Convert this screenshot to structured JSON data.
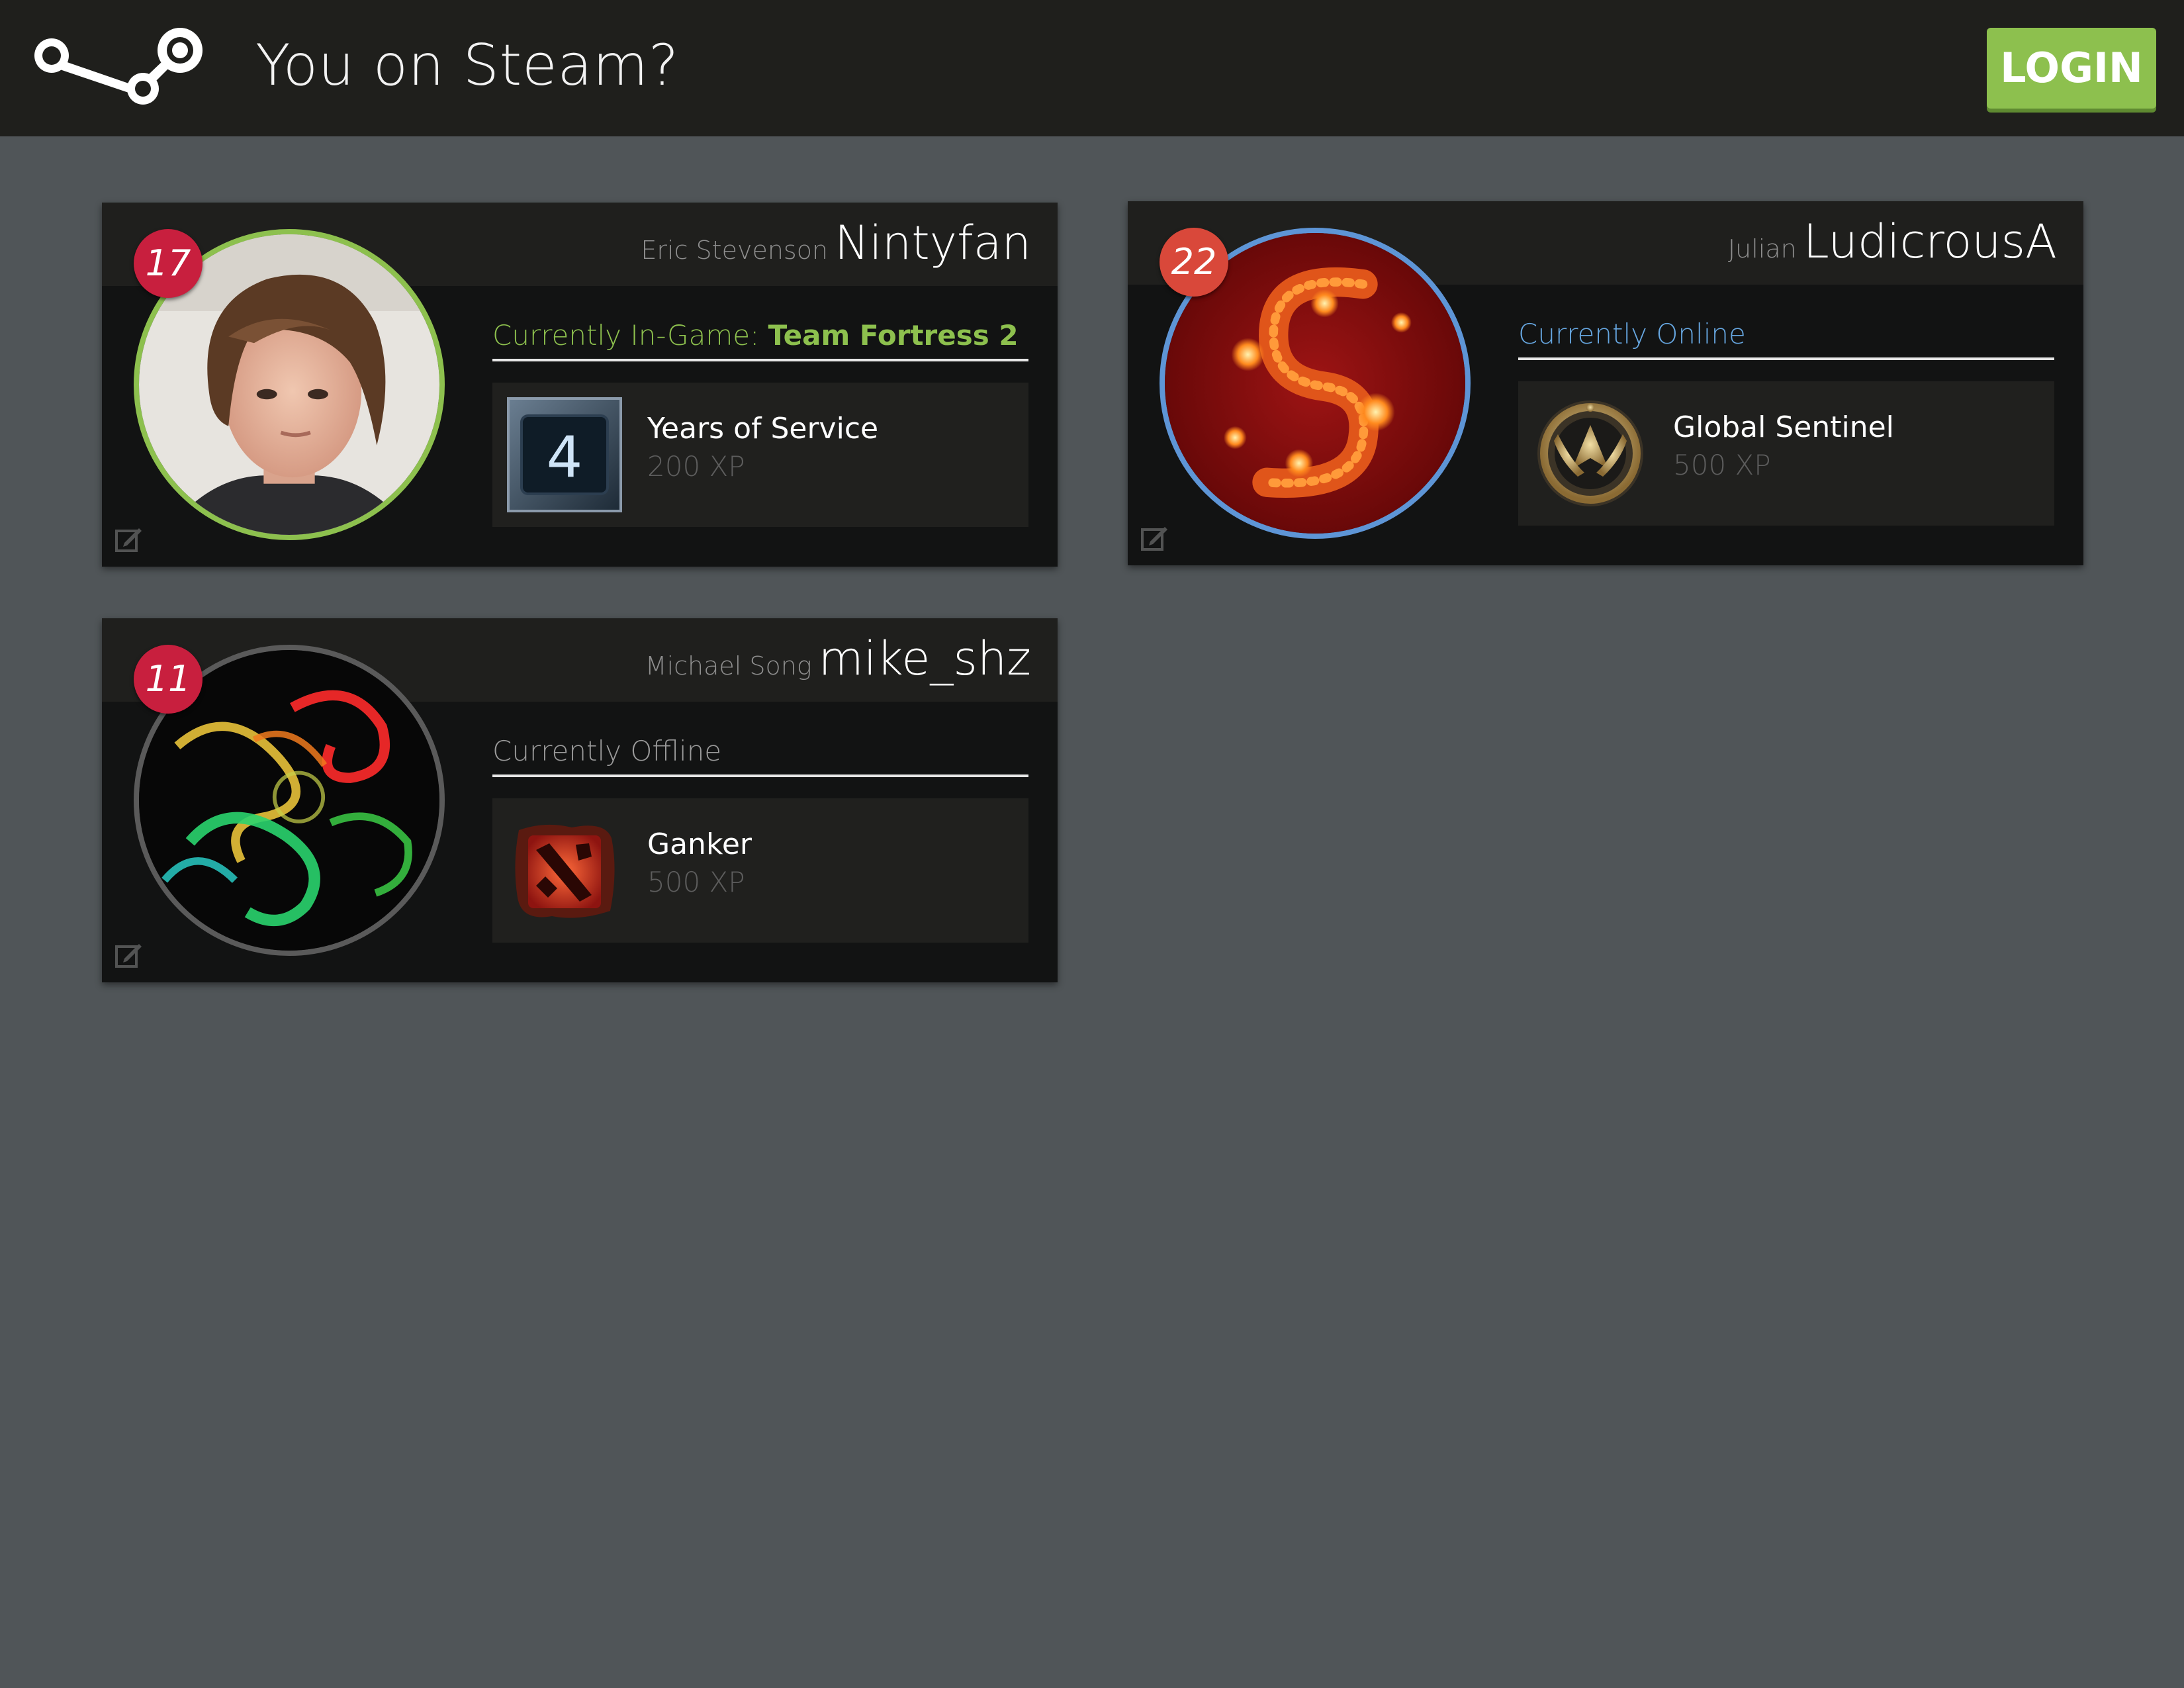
{
  "app": {
    "title": "You on Steam?",
    "login_label": "LOGIN"
  },
  "colors": {
    "header_bg": "#1f1f1c",
    "page_bg": "#505558",
    "login_green": "#8dc04e",
    "ingame_green": "#8dc04e",
    "online_blue": "#66a6e0",
    "offline_gray": "#9a9a9a",
    "level_red": "#c81f3e"
  },
  "cards": [
    {
      "real_name": "Eric Stevenson",
      "persona": "Nintyfan",
      "level": "17",
      "status_label": "Currently In-Game:",
      "status_game": "Team Fortress 2",
      "badge": {
        "icon": "years-of-service-4-icon",
        "name": "Years of Service",
        "xp": "200 XP"
      }
    },
    {
      "real_name": "Julian",
      "persona": "LudicrousA",
      "level": "22",
      "status_label": "Currently Online",
      "badge": {
        "icon": "global-sentinel-icon",
        "name": "Global Sentinel",
        "xp": "500 XP"
      }
    },
    {
      "real_name": "Michael Song",
      "persona": "mike_shz",
      "level": "11",
      "status_label": "Currently Offline",
      "badge": {
        "icon": "ganker-dota-icon",
        "name": "Ganker",
        "xp": "500 XP"
      }
    }
  ]
}
